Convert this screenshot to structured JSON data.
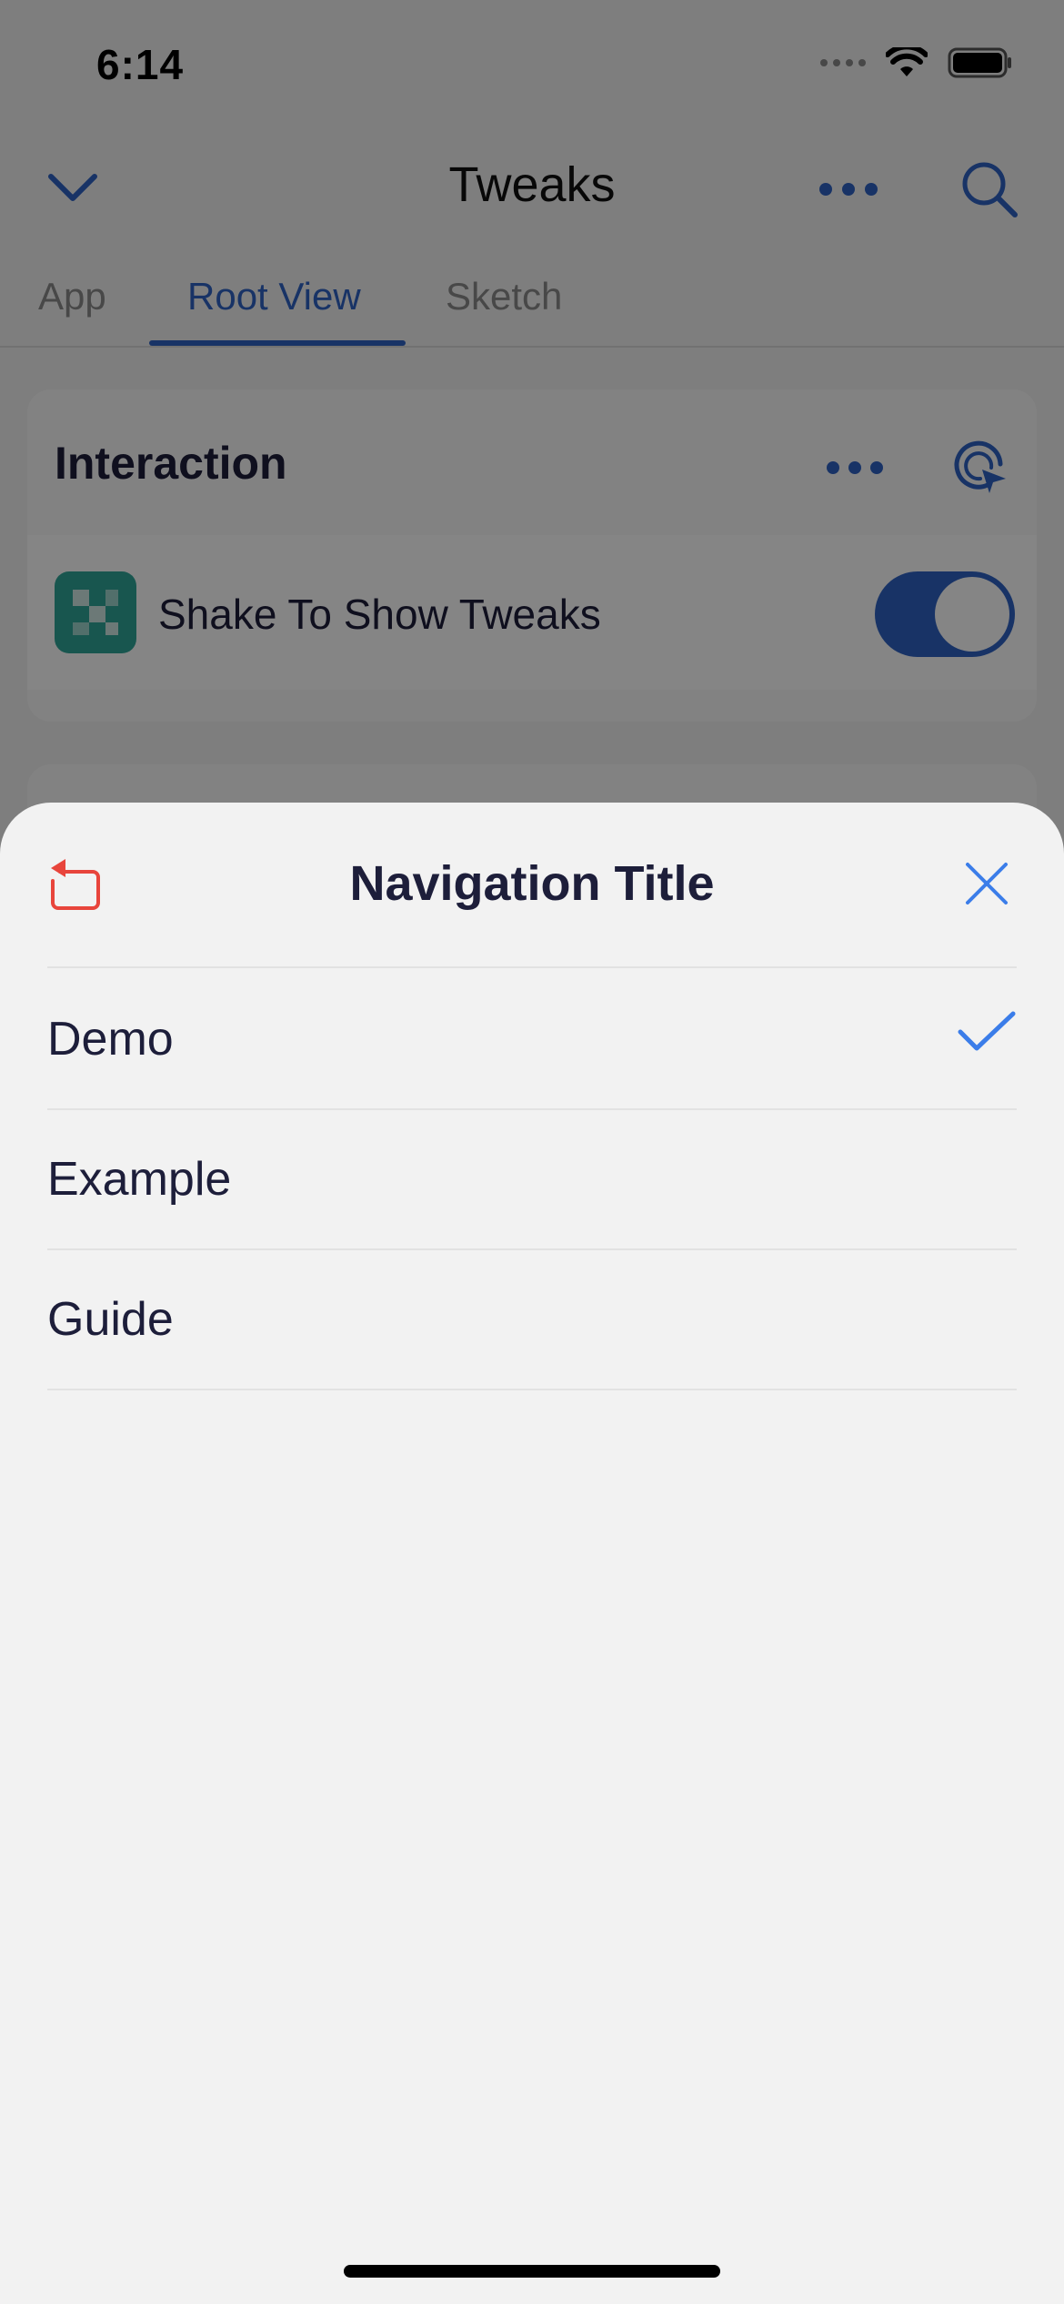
{
  "status_bar": {
    "time": "6:14"
  },
  "background": {
    "nav_title": "Tweaks",
    "tabs": [
      {
        "label": "App",
        "active": false
      },
      {
        "label": "Root View",
        "active": true
      },
      {
        "label": "Sketch",
        "active": false
      }
    ],
    "section": {
      "title": "Interaction",
      "row_label": "Shake To Show Tweaks",
      "toggle_on": true
    }
  },
  "sheet": {
    "title": "Navigation Title",
    "options": [
      {
        "label": "Demo",
        "selected": true
      },
      {
        "label": "Example",
        "selected": false
      },
      {
        "label": "Guide",
        "selected": false
      }
    ]
  },
  "colors": {
    "accent": "#2f63c4",
    "sheet_accent": "#3b7de9",
    "reset_red": "#e8453c",
    "text": "#1d1e3a"
  }
}
